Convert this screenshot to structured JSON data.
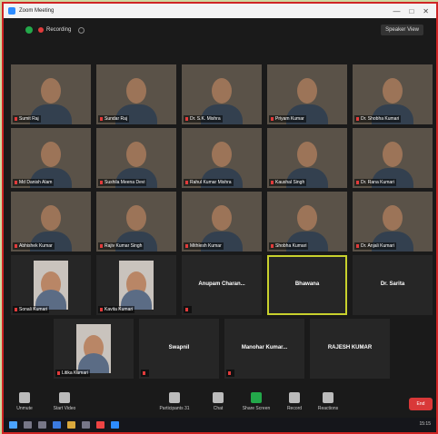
{
  "window": {
    "title": "Zoom Meeting",
    "controls": [
      "—",
      "□",
      "✕"
    ]
  },
  "topbar": {
    "recording_label": "Recording",
    "view_button": "Speaker View"
  },
  "participants_row1": [
    "Sumit Raj",
    "Sundar Raj",
    "Dr. S.K. Mishra",
    "Priyam Kumar",
    "Dr. Shobha Kumari"
  ],
  "participants_row2": [
    "Md Danish Alam",
    "Sushila Meena Devi",
    "Rahul Kumar Mishra",
    "Kaushal Singh",
    "Dr. Rana Kumari"
  ],
  "participants_row3": [
    "Abhishek Kumar",
    "Rajiv Kumar Singh",
    "Mithlesh Kumar",
    "Shobha Kumari",
    "Dr. Anjali Kumari"
  ],
  "participants_row4": {
    "video": [
      "Sonali Kumari",
      "Kavita Kumari"
    ],
    "name_only": [
      "Anupam Charan...",
      "Bhawana",
      "Dr. Sarita"
    ]
  },
  "participants_row5": {
    "video": [
      "Litika Kumari"
    ],
    "name_only": [
      "Swapnil",
      "Manohar Kumar...",
      "RAJESH KUMAR"
    ]
  },
  "toolbar": {
    "buttons": [
      "Unmute",
      "Start Video",
      "Participants",
      "Chat",
      "Share Screen",
      "Record",
      "Reactions"
    ],
    "participant_count": "31",
    "end_label": "End"
  },
  "taskbar": {
    "time": "15:15"
  },
  "colors": {
    "active_speaker": "#c8d12d",
    "end": "#d93838",
    "share": "#23a84a"
  }
}
